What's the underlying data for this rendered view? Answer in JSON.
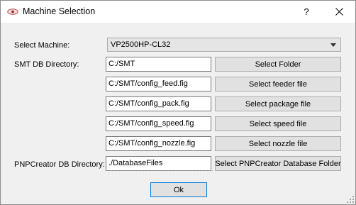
{
  "window": {
    "title": "Machine Selection",
    "help_label": "?",
    "close_label": "✕",
    "app_icon": "eye-logo-icon"
  },
  "machine": {
    "label": "Select Machine:",
    "selected": "VP2500HP-CL32"
  },
  "smt_db": {
    "label": "SMT DB Directory:",
    "rows": [
      {
        "path": "C:/SMT",
        "button": "Select Folder"
      },
      {
        "path": "C:/SMT/config_feed.fig",
        "button": "Select feeder file"
      },
      {
        "path": "C:/SMT/config_pack.fig",
        "button": "Select package file"
      },
      {
        "path": "C:/SMT/config_speed.fig",
        "button": "Select speed file"
      },
      {
        "path": "C:/SMT/config_nozzle.fig",
        "button": "Select nozzle file"
      }
    ]
  },
  "pnp": {
    "label": "PNPCreator DB Directory:",
    "path": "./DatabaseFiles",
    "button": "Select PNPCreator Database Folder"
  },
  "ok_label": "Ok",
  "colors": {
    "accent": "#0078d7",
    "dialog_bg": "#f0f0f0"
  }
}
